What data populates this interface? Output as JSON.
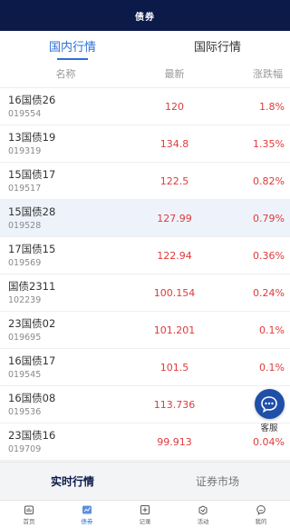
{
  "header": {
    "title": "债券"
  },
  "tabs": [
    {
      "label": "国内行情",
      "active": true
    },
    {
      "label": "国际行情",
      "active": false
    }
  ],
  "columns": {
    "name": "名称",
    "latest": "最新",
    "change": "涨跌幅"
  },
  "rows": [
    {
      "name": "16国债26",
      "code": "019554",
      "price": "120",
      "change": "1.8%"
    },
    {
      "name": "13国债19",
      "code": "019319",
      "price": "134.8",
      "change": "1.35%"
    },
    {
      "name": "15国债17",
      "code": "019517",
      "price": "122.5",
      "change": "0.82%"
    },
    {
      "name": "15国债28",
      "code": "019528",
      "price": "127.99",
      "change": "0.79%"
    },
    {
      "name": "17国债15",
      "code": "019569",
      "price": "122.94",
      "change": "0.36%"
    },
    {
      "name": "国债2311",
      "code": "102239",
      "price": "100.154",
      "change": "0.24%"
    },
    {
      "name": "23国债02",
      "code": "019695",
      "price": "101.201",
      "change": "0.1%"
    },
    {
      "name": "16国债17",
      "code": "019545",
      "price": "101.5",
      "change": "0.1%"
    },
    {
      "name": "16国债08",
      "code": "019536",
      "price": "113.736",
      "change": ""
    },
    {
      "name": "23国债16",
      "code": "019709",
      "price": "99.913",
      "change": "0.04%"
    }
  ],
  "subtabs": [
    {
      "label": "实时行情",
      "active": true
    },
    {
      "label": "证券市场",
      "active": false
    }
  ],
  "service": {
    "label": "客服",
    "icon": "chat-icon"
  },
  "nav": [
    {
      "label": "首页",
      "icon": "home-icon",
      "active": false
    },
    {
      "label": "债券",
      "icon": "bond-icon",
      "active": true
    },
    {
      "label": "记录",
      "icon": "record-icon",
      "active": false
    },
    {
      "label": "活动",
      "icon": "activity-icon",
      "active": false
    },
    {
      "label": "我的",
      "icon": "profile-icon",
      "active": false
    }
  ],
  "colors": {
    "brand": "#0c1a4a",
    "accent": "#2b6fd6",
    "up": "#e03a3a"
  }
}
